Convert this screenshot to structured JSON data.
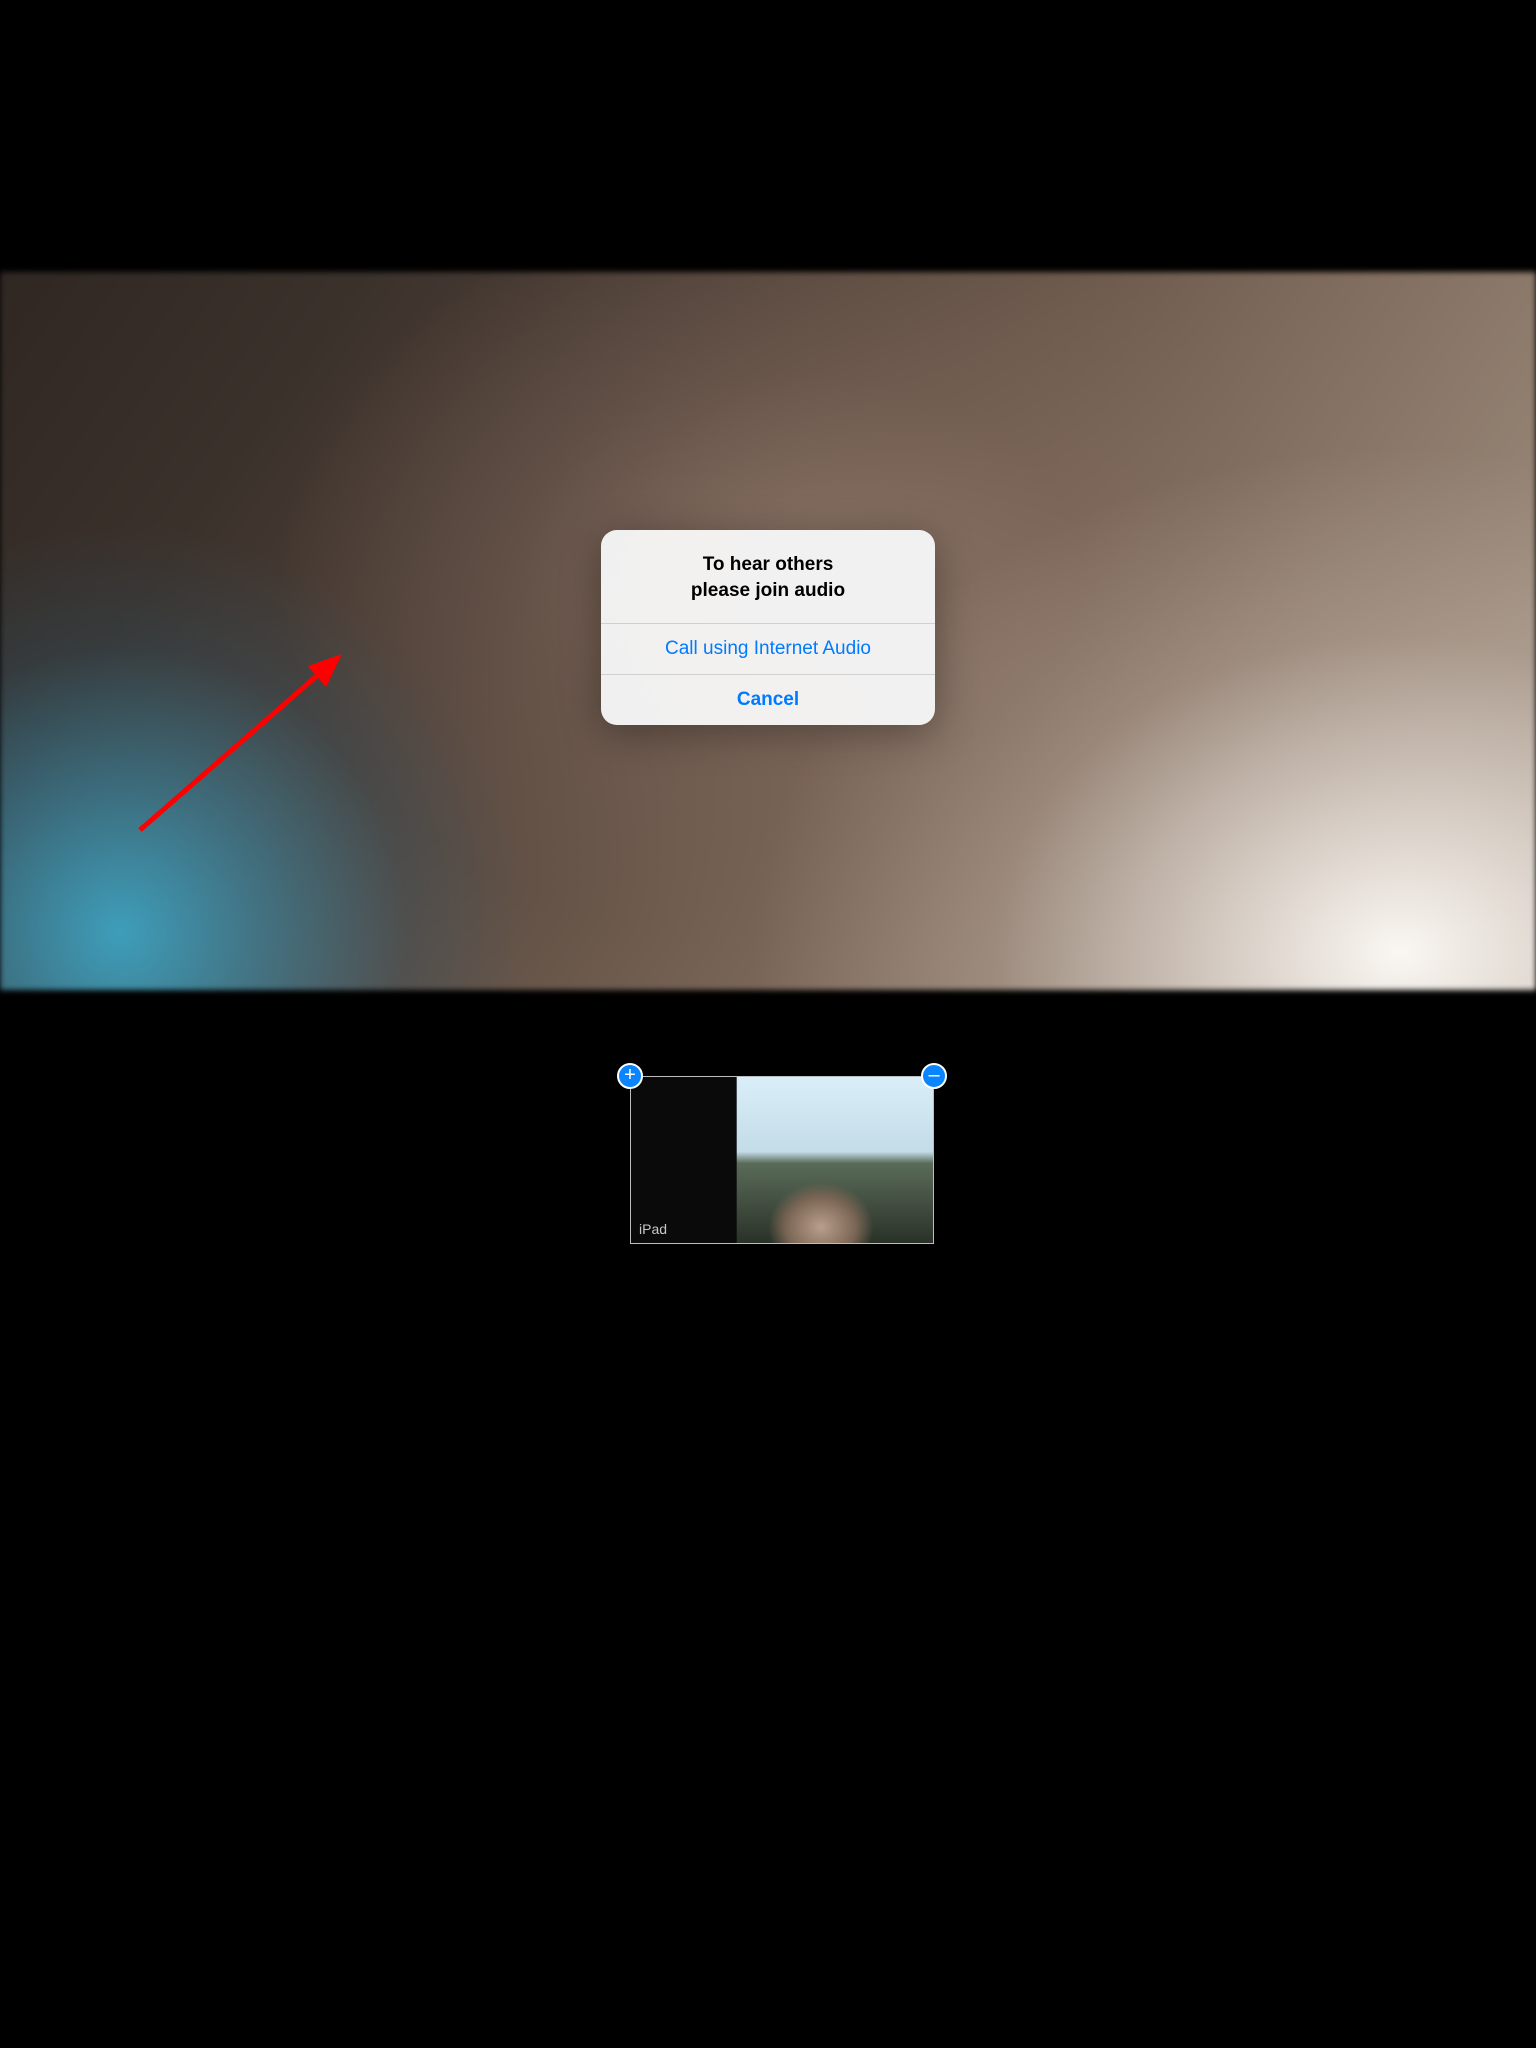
{
  "alert": {
    "title": "To hear others\nplease join audio",
    "primary_action": "Call using Internet Audio",
    "cancel_action": "Cancel"
  },
  "thumbnail": {
    "label": "iPad"
  },
  "handles": {
    "plus": "+",
    "minus": "–"
  }
}
